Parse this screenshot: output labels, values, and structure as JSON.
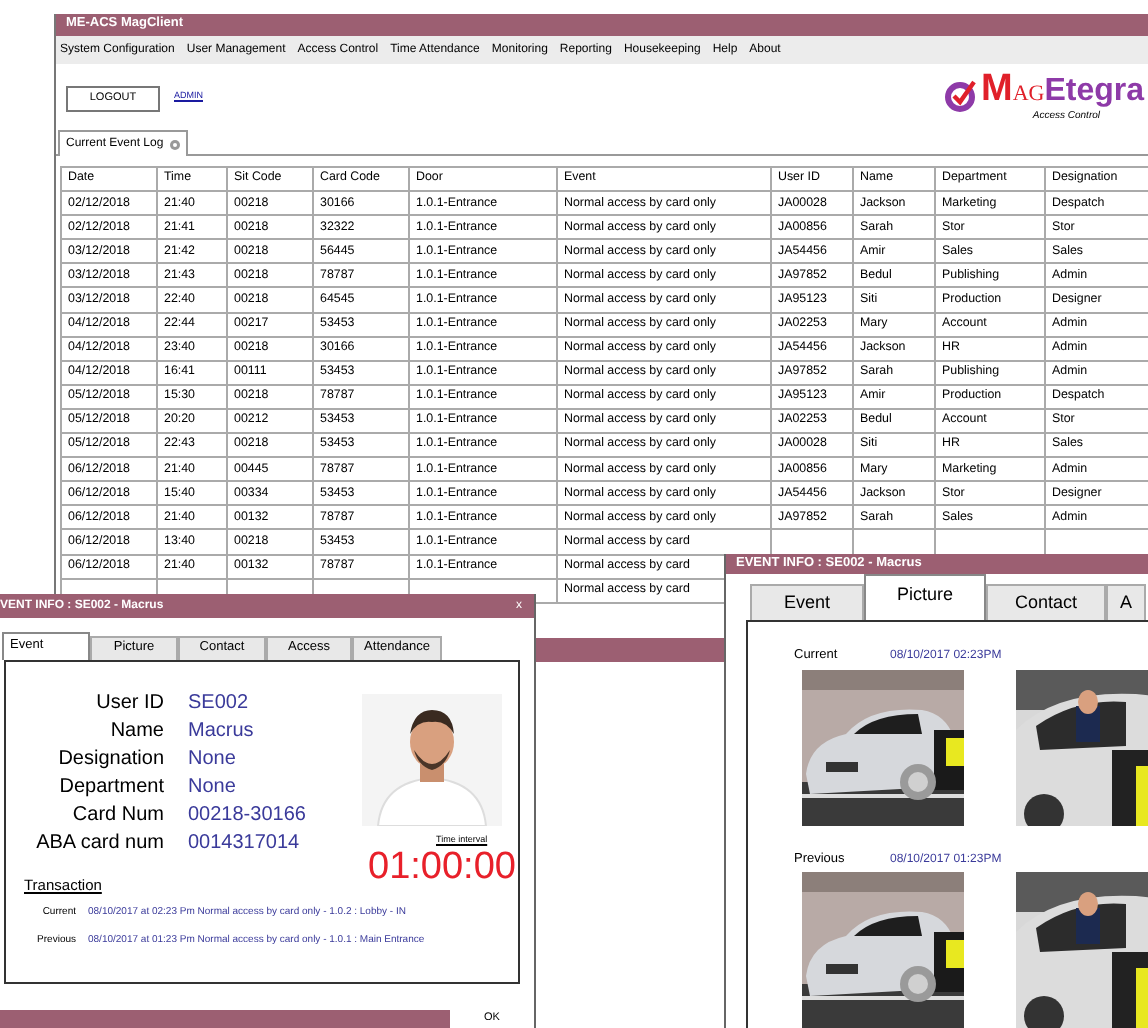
{
  "window": {
    "title": "ME-ACS MagClient"
  },
  "menu": [
    "System Configuration",
    "User Management",
    "Access Control",
    "Time Attendance",
    "Monitoring",
    "Reporting",
    "Housekeeping",
    "Help",
    "About"
  ],
  "header": {
    "logout": "LOGOUT",
    "user_link": "ADMIN",
    "logo": {
      "parts": [
        {
          "text": "M",
          "kind": "red_big"
        },
        {
          "text": "AG",
          "kind": "red_small"
        },
        {
          "text": "Etegra",
          "kind": "purple"
        }
      ],
      "tagline": "Access Control"
    }
  },
  "tabs": [
    {
      "label": "Current Event Log",
      "selected": true
    }
  ],
  "table": {
    "columns": [
      "Date",
      "Time",
      "Sit Code",
      "Card Code",
      "Door",
      "Event",
      "User ID",
      "Name",
      "Department",
      "Designation"
    ],
    "rows": [
      [
        "02/12/2018",
        "21:40",
        "00218",
        "30166",
        "1.0.1-Entrance",
        "Normal access by card only",
        "JA00028",
        "Jackson",
        "Marketing",
        "Despatch"
      ],
      [
        "02/12/2018",
        "21:41",
        "00218",
        "32322",
        "1.0.1-Entrance",
        "Normal access by card only",
        "JA00856",
        "Sarah",
        "Stor",
        "Stor"
      ],
      [
        "03/12/2018",
        "21:42",
        "00218",
        "56445",
        "1.0.1-Entrance",
        "Normal access by card only",
        "JA54456",
        "Amir",
        "Sales",
        "Sales"
      ],
      [
        "03/12/2018",
        "21:43",
        "00218",
        "78787",
        "1.0.1-Entrance",
        "Normal access by card only",
        "JA97852",
        "Bedul",
        "Publishing",
        "Admin"
      ],
      [
        "03/12/2018",
        "22:40",
        "00218",
        "64545",
        "1.0.1-Entrance",
        "Normal access by card only",
        "JA95123",
        "Siti",
        "Production",
        "Designer"
      ],
      [
        "04/12/2018",
        "22:44",
        "00217",
        "53453",
        "1.0.1-Entrance",
        "Normal access by card only",
        "JA02253",
        "Mary",
        "Account",
        "Admin"
      ],
      [
        "04/12/2018",
        "23:40",
        "00218",
        "30166",
        "1.0.1-Entrance",
        "Normal access by card only",
        "JA54456",
        "Jackson",
        "HR",
        "Admin"
      ],
      [
        "04/12/2018",
        "16:41",
        "00111",
        "53453",
        "1.0.1-Entrance",
        "Normal access by card only",
        "JA97852",
        "Sarah",
        "Publishing",
        "Admin"
      ],
      [
        "05/12/2018",
        "15:30",
        "00218",
        "78787",
        "1.0.1-Entrance",
        "Normal access by card only",
        "JA95123",
        "Amir",
        "Production",
        "Despatch"
      ],
      [
        "05/12/2018",
        "20:20",
        "00212",
        "53453",
        "1.0.1-Entrance",
        "Normal access by card only",
        "JA02253",
        "Bedul",
        "Account",
        "Stor"
      ],
      [
        "05/12/2018",
        "22:43",
        "00218",
        "53453",
        "1.0.1-Entrance",
        "Normal access by card only",
        "JA00028",
        "Siti",
        "HR",
        "Sales"
      ],
      [
        "06/12/2018",
        "21:40",
        "00445",
        "78787",
        "1.0.1-Entrance",
        "Normal access by card only",
        "JA00856",
        "Mary",
        "Marketing",
        "Admin"
      ],
      [
        "06/12/2018",
        "15:40",
        "00334",
        "53453",
        "1.0.1-Entrance",
        "Normal access by card only",
        "JA54456",
        "Jackson",
        "Stor",
        "Designer"
      ],
      [
        "06/12/2018",
        "21:40",
        "00132",
        "78787",
        "1.0.1-Entrance",
        "Normal access by card only",
        "JA97852",
        "Sarah",
        "Sales",
        "Admin"
      ],
      [
        "06/12/2018",
        "13:40",
        "00218",
        "53453",
        "1.0.1-Entrance",
        "Normal access by card",
        null,
        null,
        null,
        null
      ],
      [
        "06/12/2018",
        "21:40",
        "00132",
        "78787",
        "1.0.1-Entrance",
        "Normal access by card",
        null,
        null,
        null,
        null
      ],
      [
        null,
        null,
        null,
        null,
        null,
        "Normal access by card",
        null,
        null,
        null,
        null
      ]
    ]
  },
  "event_info_left": {
    "title": "VENT INFO : SE002 - Macrus",
    "close": "x",
    "tabs": [
      {
        "label": "Event",
        "selected": true
      },
      {
        "label": "Picture",
        "selected": false
      },
      {
        "label": "Contact",
        "selected": false
      },
      {
        "label": "Access",
        "selected": false
      },
      {
        "label": "Attendance",
        "selected": false
      }
    ],
    "fields": [
      {
        "label": "User ID",
        "value": "SE002"
      },
      {
        "label": "Name",
        "value": "Macrus"
      },
      {
        "label": "Designation",
        "value": "None"
      },
      {
        "label": "Department",
        "value": "None"
      },
      {
        "label": "Card Num",
        "value": "00218-30166"
      },
      {
        "label": "ABA card num",
        "value": "0014317014"
      }
    ],
    "time_interval": {
      "label": "Time interval",
      "value": "01:00:00"
    },
    "transaction": {
      "title": "Transaction",
      "entries": [
        {
          "label": "Current",
          "text": "08/10/2017 at 02:23 Pm Normal access by card only - 1.0.2 : Lobby - IN"
        },
        {
          "label": "Previous",
          "text": "08/10/2017 at 01:23 Pm Normal access by card only - 1.0.1 : Main Entrance"
        }
      ]
    },
    "ok_button": "OK"
  },
  "event_info_right": {
    "title": "EVENT INFO : SE002 - Macrus",
    "tabs": [
      {
        "label": "Event",
        "selected": false
      },
      {
        "label": "Picture",
        "selected": true
      },
      {
        "label": "Contact",
        "selected": false
      },
      {
        "label": "A",
        "selected": false
      }
    ],
    "pictures": [
      {
        "label": "Current",
        "time": "08/10/2017 02:23PM"
      },
      {
        "label": "Previous",
        "time": "08/10/2017 01:23PM"
      }
    ]
  }
}
